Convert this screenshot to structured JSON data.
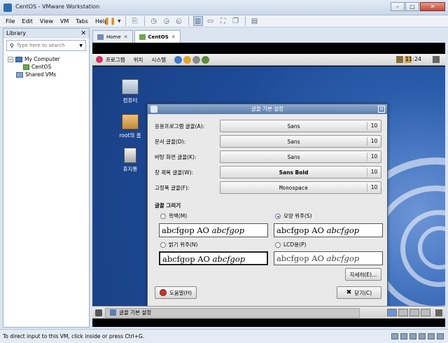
{
  "window": {
    "title": "CentOS - VMware Workstation"
  },
  "menubar": [
    "File",
    "Edit",
    "View",
    "VM",
    "Tabs",
    "Help"
  ],
  "library": {
    "header": "Library",
    "search_placeholder": "Type here to search",
    "tree": {
      "root": "My Computer",
      "vm": "CentOS",
      "shared": "Shared VMs"
    }
  },
  "tabs": [
    {
      "label": "Home"
    },
    {
      "label": "CentOS"
    }
  ],
  "guest": {
    "panel_menus": [
      "프로그램",
      "위치",
      "시스템"
    ],
    "clock": "11:24",
    "desktop_icons": [
      "컴퓨터",
      "root의 홈",
      "휴지통"
    ],
    "taskbar_item": "글꼴 기본 설정"
  },
  "dialog": {
    "title": "글꼴 기본 설정",
    "fonts": [
      {
        "label": "응용프로그램 글꼴(A):",
        "name": "Sans",
        "size": "10"
      },
      {
        "label": "문서 글꼴(D):",
        "name": "Sans",
        "size": "10"
      },
      {
        "label": "바탕 화면 글꼴(K):",
        "name": "Sans",
        "size": "10"
      },
      {
        "label": "창 제목 글꼴(W):",
        "name": "Sans Bold",
        "size": "10"
      },
      {
        "label": "고정폭 글꼴(F):",
        "name": "Monospace",
        "size": "10"
      }
    ],
    "rendering_title": "글꼴 그리기",
    "options": [
      {
        "label": "흑백(M)",
        "selected": false
      },
      {
        "label": "모양 위주(S)",
        "selected": true
      },
      {
        "label": "밝기 위주(N)",
        "selected": false
      },
      {
        "label": "LCD용(P)",
        "selected": false
      }
    ],
    "sample_plain": "abcfgop AO",
    "sample_italic": "abcfgop",
    "details_button": "자세히(E)...",
    "help_button": "도움말(H)",
    "close_button": "닫기(C)"
  },
  "statusbar": {
    "text": "To direct input to this VM, click inside or press Ctrl+G."
  }
}
